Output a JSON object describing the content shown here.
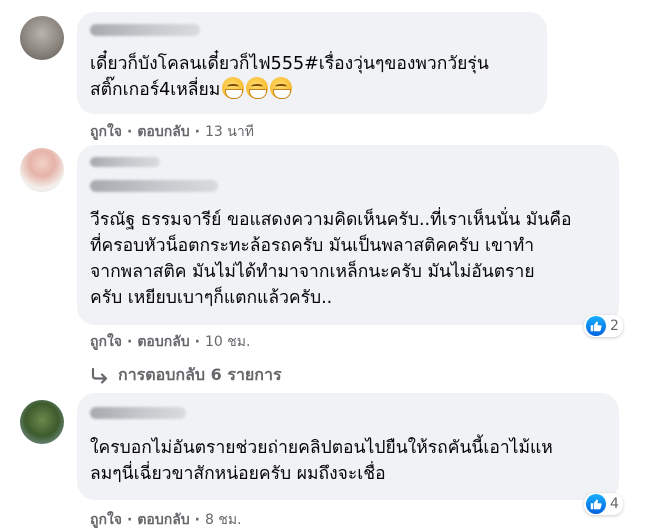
{
  "comments": [
    {
      "text_line1": "เดี๋ยวก็บังโคลนเดี๋ยวก็ไฟ555#เรื่องวุ่นๆของพวกวัยรุ่น",
      "text_line2": "สติ๊กเกอร์4เหลี่ยม",
      "emojis": [
        "grin-face-icon",
        "grin-face-icon",
        "grin-face-icon"
      ],
      "like_label": "ถูกใจ",
      "reply_label": "ตอบกลับ",
      "time": "13 นาที"
    },
    {
      "text_line1": "วีรณัฐ ธรรมจารีย์ ขอแสดงความคิดเห็นครับ..ที่เราเห็นนั่น มันคือ",
      "text_line2": "ที่ครอบหัวน็อตกระทะล้อรถครับ มันเป็นพลาสติคครับ เขาทำ",
      "text_line3": "จากพลาสติค มันไม่ได้ทำมาจากเหล็กนะครับ มันไม่อันตราย",
      "text_line4": "ครับ เหยียบเบาๆก็แตกแล้วครับ..",
      "like_label": "ถูกใจ",
      "reply_label": "ตอบกลับ",
      "time": "10 ชม.",
      "reaction_count": "2"
    },
    {
      "text_line1": "ใครบอกไม่อันตรายช่วยถ่ายคลิปตอนไปยืนให้รถคันนี้เอาไม้แห",
      "text_line2": "ลมๆนี่เฉี่ยวขาสักหน่อยครับ ผมถึงจะเชื่อ",
      "like_label": "ถูกใจ",
      "reply_label": "ตอบกลับ",
      "time": "8 ชม.",
      "reaction_count": "4"
    }
  ],
  "replies_link": "การตอบกลับ 6 รายการ",
  "separator": "·",
  "colors": {
    "bubble": "#f0f2f5",
    "meta_text": "#65676b",
    "like_blue": "#1877f2"
  }
}
